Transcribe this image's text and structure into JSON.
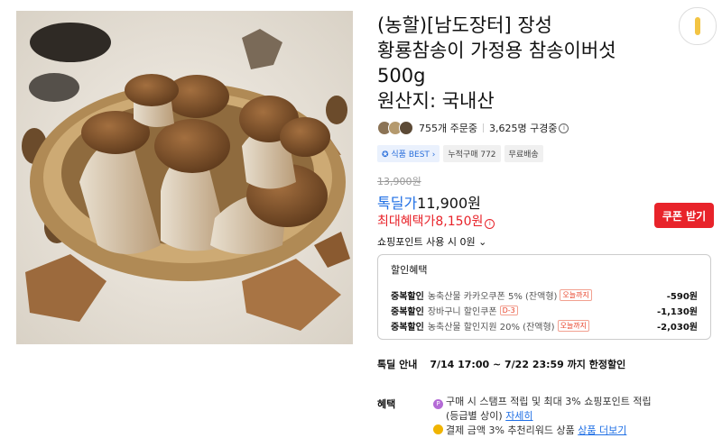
{
  "product": {
    "title_lines": [
      "(농할)[남도장터] 장성",
      "황룡참송이 가정용 참송이버섯",
      "500g",
      "원산지: 국내산"
    ]
  },
  "rating": {
    "orders": "755개 주문중",
    "subscribers": "3,625명 구경중"
  },
  "badges": [
    "식품 BEST",
    "누적구매 772",
    "무료배송"
  ],
  "price": {
    "original": "13,900원",
    "deal_label": "톡딜가",
    "deal_value": "11,900원",
    "max_benefit": "최대혜택가8,150원",
    "coupon_button": "쿠폰 받기",
    "points": "쇼핑포인트 사용 시 0원"
  },
  "discounts": {
    "title": "할인혜택",
    "rows": [
      {
        "label": "중복할인",
        "name": "농축산물 카카오쿠폰 5% (잔액형)",
        "tag": "오늘까지",
        "amount": "-590원"
      },
      {
        "label": "중복할인",
        "name": "장바구니 할인쿠폰",
        "tag": "D-3",
        "amount": "-1,130원"
      },
      {
        "label": "중복할인",
        "name": "농축산물 할인지원 20% (잔액형)",
        "tag": "오늘까지",
        "amount": "-2,030원"
      }
    ]
  },
  "deal_info": {
    "label": "톡딜 안내",
    "period": "7/14 17:00 ~ 7/22 23:59 까지 한정할인"
  },
  "benefits": {
    "label": "혜택",
    "line1": "구매 시 스탬프 적립 및 최대 3% 쇼핑포인트 적립",
    "line2": "(등급별 상이)",
    "line2_link": "자세히",
    "line3": "결제 금액 3% 추천리워드 상품",
    "line3_link": "상품 더보기"
  },
  "icons": {
    "side": "side-toggle-icon",
    "badge": "best-icon",
    "bullet": "point-icon"
  }
}
